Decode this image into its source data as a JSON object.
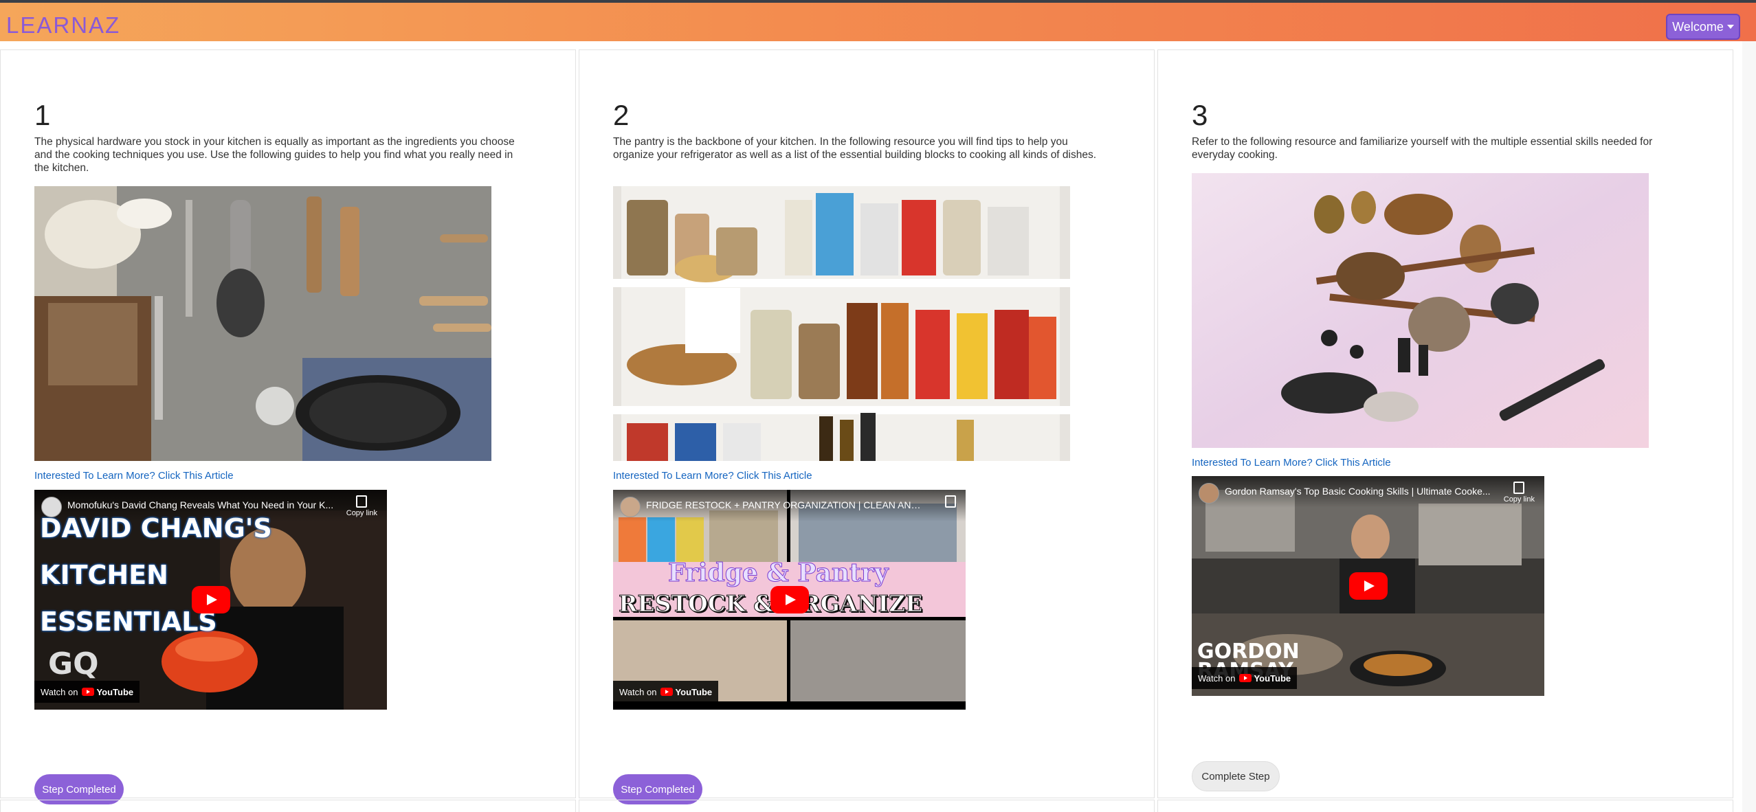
{
  "header": {
    "brand": "LEARNAZ",
    "welcome_label": "Welcome"
  },
  "steps": [
    {
      "number": "1",
      "description": "The physical hardware you stock in your kitchen is equally as important as the ingredients you choose and the cooking techniques you use. Use the following guides to help you find what you really need in the kitchen.",
      "link_text": "Interested To Learn More? Click This Article",
      "video": {
        "title": "Momofuku's David Chang Reveals What You Need in Your K...",
        "copy_label": "Copy link",
        "watch_on": "Watch on",
        "overlay_lines": [
          "DAVID CHANG'S",
          "KITCHEN",
          "ESSENTIALS"
        ],
        "overlay_badge": "GQ"
      },
      "button_label": "Step Completed",
      "status": "completed"
    },
    {
      "number": "2",
      "description": "The pantry is the backbone of your kitchen. In the following resource you will find tips to help you organize your refrigerator as well as a list of the essential building blocks to cooking all kinds of dishes.",
      "link_text": "Interested To Learn More? Click This Article",
      "video": {
        "title": "FRIDGE RESTOCK + PANTRY ORGANIZATION | CLEAN AND ...",
        "copy_label": "Copy link",
        "watch_on": "Watch on",
        "overlay_lines": [
          "Fridge & Pantry",
          "RESTOCK & ORGANIZE"
        ]
      },
      "button_label": "Step Completed",
      "status": "completed"
    },
    {
      "number": "3",
      "description": "Refer to the following resource and familiarize yourself with the multiple essential skills needed for everyday cooking.",
      "link_text": "Interested To Learn More? Click This Article",
      "video": {
        "title": "Gordon Ramsay's Top Basic Cooking Skills | Ultimate Cooke...",
        "copy_label": "Copy link",
        "watch_on": "Watch on",
        "overlay_lines": [
          "GORDON",
          "RAMSAY"
        ]
      },
      "button_label": "Complete Step",
      "status": "pending"
    }
  ],
  "youtube_label": "YouTube",
  "colors": {
    "accent": "#8c61d8",
    "link": "#1565c0",
    "header_gradient_start": "#f5a65a",
    "header_gradient_end": "#f0704a"
  }
}
